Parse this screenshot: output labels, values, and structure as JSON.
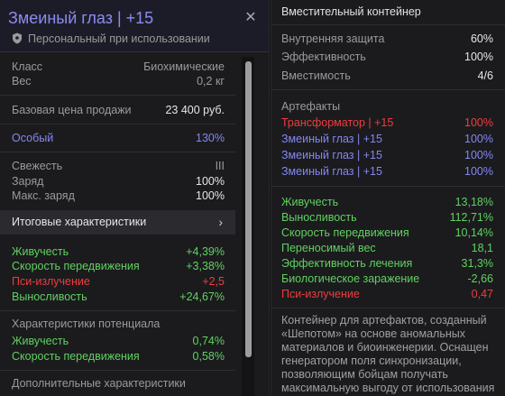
{
  "item": {
    "title": "Змеиный глаз | +15",
    "binding": "Персональный при использовании",
    "class_label": "Класс",
    "class_value": "Биохимические",
    "weight_label": "Вес",
    "weight_value": "0,2 кг",
    "price_label": "Базовая цена продажи",
    "price_value": "23 400 руб.",
    "special_label": "Особый",
    "special_value": "130%",
    "freshness_label": "Свежесть",
    "freshness_value": "III",
    "charge_label": "Заряд",
    "charge_value": "100%",
    "maxcharge_label": "Макс. заряд",
    "maxcharge_value": "100%",
    "summary_label": "Итоговые характеристики",
    "stats": [
      {
        "label": "Живучесть",
        "value": "+4,39%",
        "color": "#5fd25f"
      },
      {
        "label": "Скорость передвижения",
        "value": "+3,38%",
        "color": "#5fd25f"
      },
      {
        "label": "Пси-излучение",
        "value": "+2,5",
        "color": "#ee3d3d"
      },
      {
        "label": "Выносливость",
        "value": "+24,67%",
        "color": "#5fd25f"
      }
    ],
    "potential_title": "Характеристики потенциала",
    "potential": [
      {
        "label": "Живучесть",
        "value": "0,74%"
      },
      {
        "label": "Скорость передвижения",
        "value": "0,58%"
      }
    ],
    "extra_title": "Дополнительные характеристики"
  },
  "container": {
    "title": "Вместительный контейнер",
    "internal_label": "Внутренняя защита",
    "internal_value": "60%",
    "efficiency_label": "Эффективность",
    "efficiency_value": "100%",
    "capacity_label": "Вместимость",
    "capacity_value": "4/6",
    "artifacts_title": "Артефакты",
    "artifacts": [
      {
        "name": "Трансформатор | +15",
        "value": "100%",
        "color": "#ee3d3d"
      },
      {
        "name": "Змеиный глаз | +15",
        "value": "100%",
        "color": "#8487f0"
      },
      {
        "name": "Змеиный глаз | +15",
        "value": "100%",
        "color": "#8487f0"
      },
      {
        "name": "Змеиный глаз | +15",
        "value": "100%",
        "color": "#8487f0"
      }
    ],
    "totals": [
      {
        "label": "Живучесть",
        "value": "13,18%",
        "color": "#5fd25f"
      },
      {
        "label": "Выносливость",
        "value": "112,71%",
        "color": "#5fd25f"
      },
      {
        "label": "Скорость передвижения",
        "value": "10,14%",
        "color": "#5fd25f"
      },
      {
        "label": "Переносимый вес",
        "value": "18,1",
        "color": "#5fd25f"
      },
      {
        "label": "Эффективность лечения",
        "value": "31,3%",
        "color": "#5fd25f"
      },
      {
        "label": "Биологическое заражение",
        "value": "-2,66",
        "color": "#5fd25f"
      },
      {
        "label": "Пси-излучение",
        "value": "0,47",
        "color": "#ee3d3d"
      }
    ],
    "description": "Контейнер для артефактов, созданный «Шепотом» на основе аномальных материалов и биоинженерии. Оснащен генератором поля синхронизации, позволяющим бойцам получать максимальную выгоду от использования артефакта. Испытания на обычных"
  },
  "colors": {
    "rare_blue": "#8487f0",
    "positive": "#5fd25f",
    "negative": "#ee3d3d"
  },
  "icons": {
    "close": "close-icon",
    "shield": "shield-icon",
    "chevron": "chevron-right-icon"
  }
}
